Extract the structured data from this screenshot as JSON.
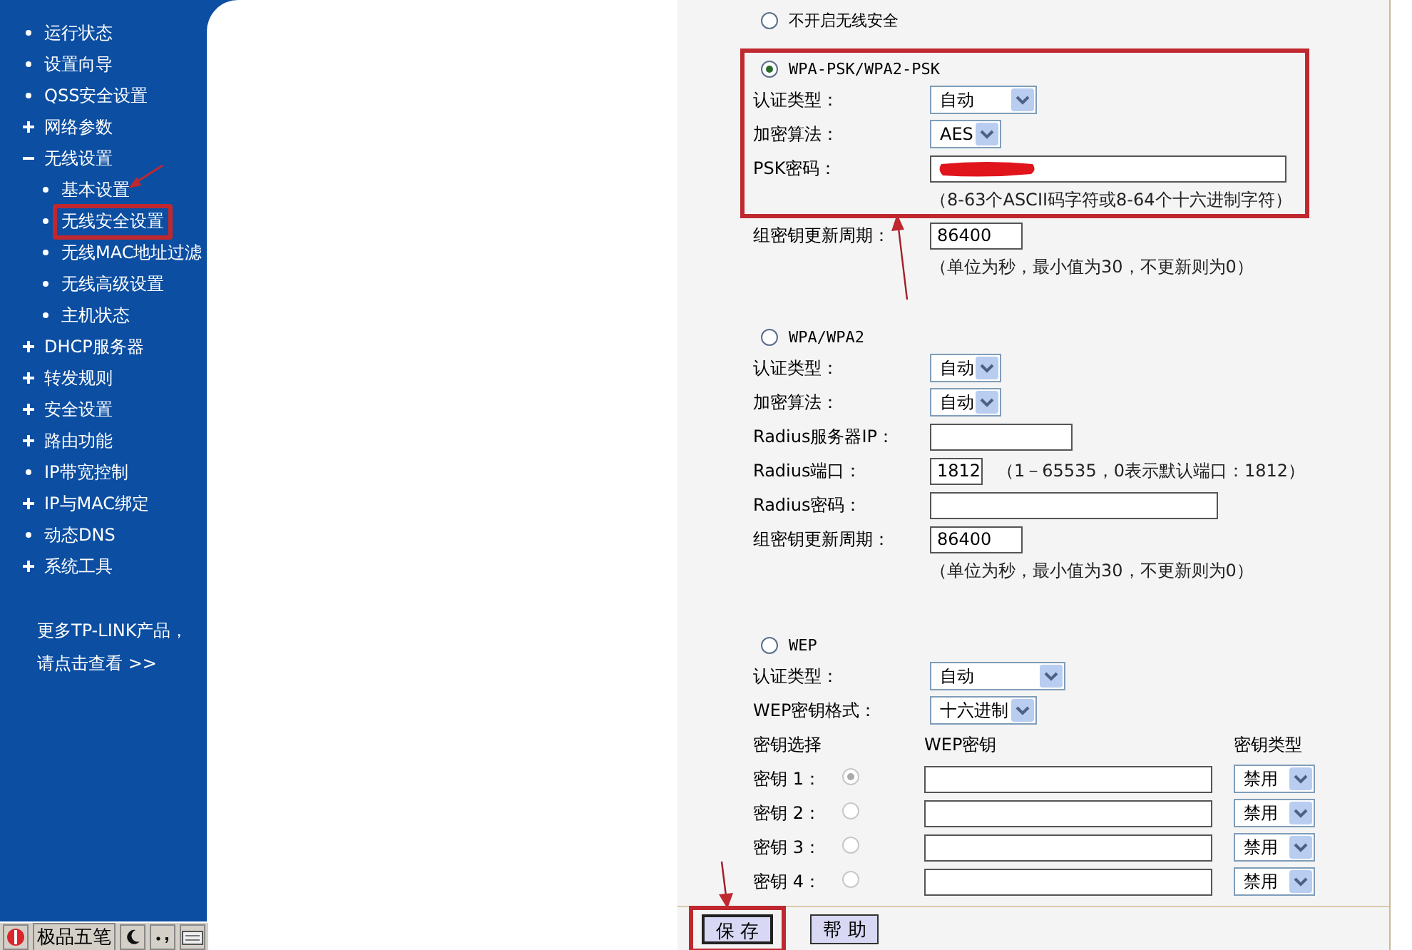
{
  "sidebar": {
    "items": [
      {
        "kind": "leaf",
        "label": "运行状态",
        "highlighted": false
      },
      {
        "kind": "leaf",
        "label": "设置向导",
        "highlighted": false
      },
      {
        "kind": "leaf",
        "label": "QSS安全设置",
        "highlighted": false
      },
      {
        "kind": "group",
        "label": "网络参数",
        "expanded": false,
        "highlighted": false
      },
      {
        "kind": "group",
        "label": "无线设置",
        "expanded": true,
        "highlighted": false,
        "children": [
          {
            "kind": "leaf",
            "label": "基本设置",
            "highlighted": false
          },
          {
            "kind": "leaf",
            "label": "无线安全设置",
            "highlighted": true
          },
          {
            "kind": "leaf",
            "label": "无线MAC地址过滤",
            "highlighted": false
          },
          {
            "kind": "leaf",
            "label": "无线高级设置",
            "highlighted": false
          },
          {
            "kind": "leaf",
            "label": "主机状态",
            "highlighted": false
          }
        ]
      },
      {
        "kind": "group",
        "label": "DHCP服务器",
        "expanded": false,
        "highlighted": false
      },
      {
        "kind": "group",
        "label": "转发规则",
        "expanded": false,
        "highlighted": false
      },
      {
        "kind": "group",
        "label": "安全设置",
        "expanded": false,
        "highlighted": false
      },
      {
        "kind": "group",
        "label": "路由功能",
        "expanded": false,
        "highlighted": false
      },
      {
        "kind": "leaf",
        "label": "IP带宽控制",
        "highlighted": false
      },
      {
        "kind": "group",
        "label": "IP与MAC绑定",
        "expanded": false,
        "highlighted": false
      },
      {
        "kind": "leaf",
        "label": "动态DNS",
        "highlighted": false
      },
      {
        "kind": "group",
        "label": "系统工具",
        "expanded": false,
        "highlighted": false
      }
    ],
    "promo": [
      "更多TP-LINK产品，",
      "请点击查看 >>"
    ]
  },
  "security_modes": [
    {
      "kind": "none",
      "label": "不开启无线安全",
      "selected": false,
      "highlighted": false
    },
    {
      "kind": "wpa_psk",
      "label": "WPA-PSK/WPA2-PSK",
      "selected": true,
      "highlighted": true,
      "fields": [
        {
          "kind": "select",
          "label": "认证类型：",
          "value": "自动"
        },
        {
          "kind": "select",
          "label": "加密算法：",
          "value": "AES"
        },
        {
          "kind": "input",
          "label": "PSK密码：",
          "redacted": true
        },
        {
          "kind": "note",
          "text": "（8-63个ASCII码字符或8-64个十六进制字符）"
        }
      ],
      "extra_fields": [
        {
          "kind": "input",
          "label": "组密钥更新周期：",
          "value": "86400"
        },
        {
          "kind": "note",
          "text": "（单位为秒，最小值为30，不更新则为0）"
        }
      ]
    },
    {
      "kind": "wpa",
      "label": "WPA/WPA2",
      "selected": false,
      "highlighted": false,
      "fields": [
        {
          "kind": "select",
          "label": "认证类型：",
          "value": "自动"
        },
        {
          "kind": "select",
          "label": "加密算法：",
          "value": "自动"
        },
        {
          "kind": "input",
          "label": "Radius服务器IP："
        },
        {
          "kind": "input",
          "label": "Radius端口：",
          "value": "1812",
          "note": "（1－65535，0表示默认端口：1812）"
        },
        {
          "kind": "input",
          "label": "Radius密码："
        },
        {
          "kind": "input",
          "label": "组密钥更新周期：",
          "value": "86400"
        },
        {
          "kind": "note",
          "text": "（单位为秒，最小值为30，不更新则为0）"
        }
      ]
    },
    {
      "kind": "wep",
      "label": "WEP",
      "selected": false,
      "highlighted": false,
      "fields": [
        {
          "kind": "select",
          "label": "认证类型：",
          "value": "自动"
        },
        {
          "kind": "select",
          "label": "WEP密钥格式：",
          "value": "十六进制"
        },
        {
          "kind": "keys",
          "columns": [
            "密钥选择",
            "WEP密钥",
            "密钥类型"
          ],
          "rows": [
            {
              "label": "密钥 1：",
              "selected": true,
              "disabled": true,
              "type": "禁用"
            },
            {
              "label": "密钥 2：",
              "selected": false,
              "disabled": true,
              "type": "禁用"
            },
            {
              "label": "密钥 3：",
              "selected": false,
              "disabled": true,
              "type": "禁用"
            },
            {
              "label": "密钥 4：",
              "selected": false,
              "disabled": true,
              "type": "禁用"
            }
          ]
        }
      ]
    }
  ],
  "buttons": [
    {
      "label": "保 存",
      "highlighted": true
    },
    {
      "label": "帮 助",
      "highlighted": false
    }
  ],
  "ime_toolbar": {
    "label": "极品五笔"
  }
}
